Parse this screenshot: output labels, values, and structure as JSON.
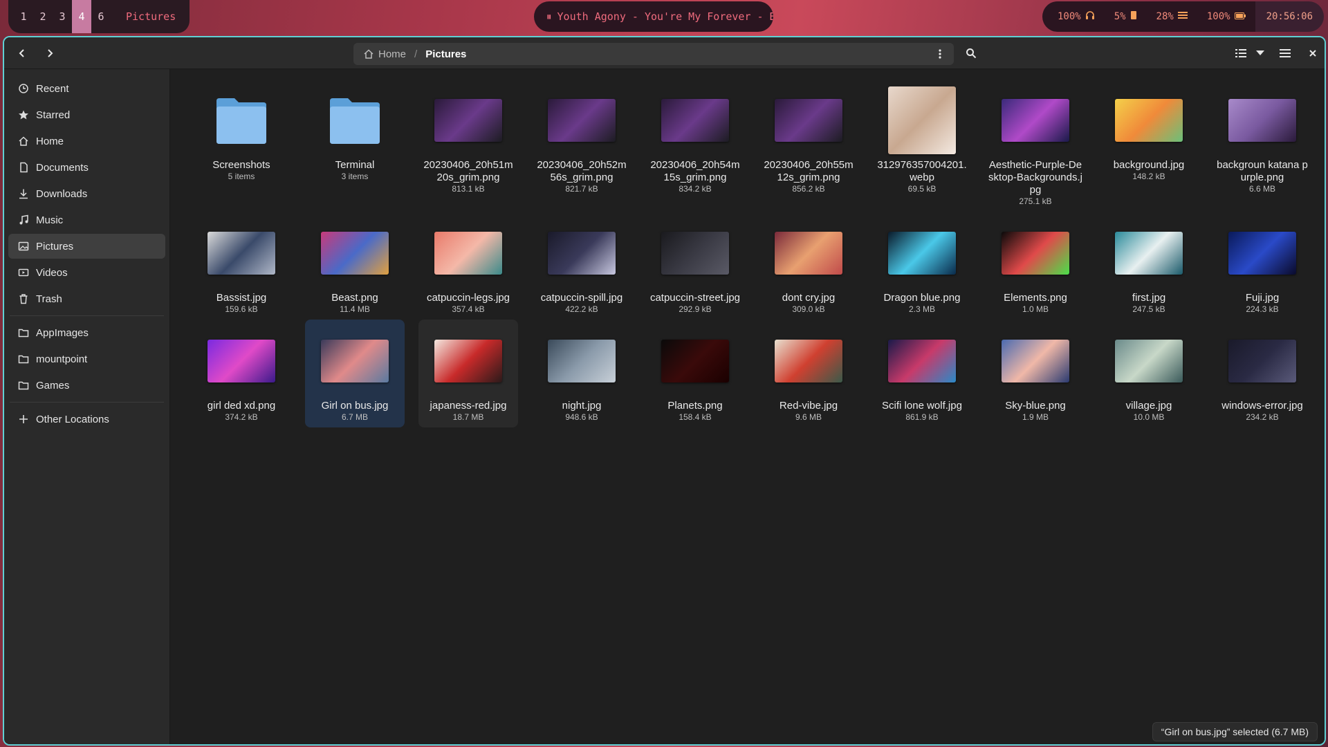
{
  "topbar": {
    "workspaces": [
      "1",
      "2",
      "3",
      "4",
      "6"
    ],
    "active_workspace": "4",
    "window_title": "Pictures",
    "media": {
      "icon": "pause-icon",
      "text": "Youth Agony - You're My Forever - Be"
    },
    "status": [
      {
        "value": "100%",
        "icon": "headphones-icon"
      },
      {
        "value": "5%",
        "icon": "battery-low-icon"
      },
      {
        "value": "28%",
        "icon": "memory-icon"
      },
      {
        "value": "100%",
        "icon": "battery-full-icon"
      }
    ],
    "clock": "20:56:06"
  },
  "headerbar": {
    "breadcrumb": {
      "home": "Home",
      "current": "Pictures"
    }
  },
  "sidebar": {
    "items": [
      {
        "label": "Recent",
        "icon": "clock-icon"
      },
      {
        "label": "Starred",
        "icon": "star-icon"
      },
      {
        "label": "Home",
        "icon": "home-icon"
      },
      {
        "label": "Documents",
        "icon": "document-icon"
      },
      {
        "label": "Downloads",
        "icon": "download-icon"
      },
      {
        "label": "Music",
        "icon": "music-icon"
      },
      {
        "label": "Pictures",
        "icon": "picture-icon",
        "active": true
      },
      {
        "label": "Videos",
        "icon": "video-icon"
      },
      {
        "label": "Trash",
        "icon": "trash-icon"
      }
    ],
    "places": [
      {
        "label": "AppImages",
        "icon": "folder-icon"
      },
      {
        "label": "mountpoint",
        "icon": "folder-icon"
      },
      {
        "label": "Games",
        "icon": "folder-icon"
      }
    ],
    "other": {
      "label": "Other Locations",
      "icon": "plus-icon"
    }
  },
  "files": [
    {
      "name": "Screenshots",
      "size": "5 items",
      "kind": "folder"
    },
    {
      "name": "Terminal",
      "size": "3 items",
      "kind": "folder"
    },
    {
      "name": "20230406_20h51m20s_grim.png",
      "size": "813.1 kB",
      "colors": [
        "#2a1a3a",
        "#6a3a8a",
        "#1c1c22"
      ]
    },
    {
      "name": "20230406_20h52m56s_grim.png",
      "size": "821.7 kB",
      "colors": [
        "#2a1a3a",
        "#6a3a8a",
        "#1c1c22"
      ]
    },
    {
      "name": "20230406_20h54m15s_grim.png",
      "size": "834.2 kB",
      "colors": [
        "#2a1a3a",
        "#6a3a8a",
        "#1c1c22"
      ]
    },
    {
      "name": "20230406_20h55m12s_grim.png",
      "size": "856.2 kB",
      "colors": [
        "#2a1a3a",
        "#6a3a8a",
        "#1c1c22"
      ]
    },
    {
      "name": "312976357004201.webp",
      "size": "69.5 kB",
      "colors": [
        "#e8d8cc",
        "#c8a890",
        "#f4eae2"
      ],
      "tall": true
    },
    {
      "name": "Aesthetic-Purple-Desktop-Backgrounds.jpg",
      "size": "275.1 kB",
      "colors": [
        "#3a2a7a",
        "#b04ac8",
        "#1a1a4a"
      ]
    },
    {
      "name": "background.jpg",
      "size": "148.2 kB",
      "colors": [
        "#f4d04a",
        "#f08a3a",
        "#6ac07a"
      ]
    },
    {
      "name": "backgroun katana purple.png",
      "size": "6.6 MB",
      "colors": [
        "#a88aca",
        "#7a5aa0",
        "#2a1a3a"
      ]
    },
    {
      "name": "Bassist.jpg",
      "size": "159.6 kB",
      "colors": [
        "#dadada",
        "#3a4a6a",
        "#b0b8c8"
      ]
    },
    {
      "name": "Beast.png",
      "size": "11.4 MB",
      "colors": [
        "#c83a7a",
        "#4a6ac8",
        "#e0a040"
      ]
    },
    {
      "name": "catpuccin-legs.jpg",
      "size": "357.4 kB",
      "colors": [
        "#e87a6a",
        "#f4b8a8",
        "#3a8a8a"
      ]
    },
    {
      "name": "catpuccin-spill.jpg",
      "size": "422.2 kB",
      "colors": [
        "#1a1a2a",
        "#3a3a5a",
        "#c8c8e0"
      ]
    },
    {
      "name": "catpuccin-street.jpg",
      "size": "292.9 kB",
      "colors": [
        "#1a1a1e",
        "#3a3a44",
        "#5a5a66"
      ]
    },
    {
      "name": "dont cry.jpg",
      "size": "309.0 kB",
      "colors": [
        "#7a2a3a",
        "#e8a070",
        "#c04a4a"
      ]
    },
    {
      "name": "Dragon blue.png",
      "size": "2.3 MB",
      "colors": [
        "#0a1a2a",
        "#4ac8e8",
        "#0a2a4a"
      ]
    },
    {
      "name": "Elements.png",
      "size": "1.0 MB",
      "colors": [
        "#0a0a0a",
        "#e04a4a",
        "#4ae04a"
      ]
    },
    {
      "name": "first.jpg",
      "size": "247.5 kB",
      "colors": [
        "#2a8a9a",
        "#e8f0f0",
        "#1a5a6a"
      ]
    },
    {
      "name": "Fuji.jpg",
      "size": "224.3 kB",
      "colors": [
        "#0a1a5a",
        "#2a4ac8",
        "#0a0a2a"
      ]
    },
    {
      "name": "girl ded xd.png",
      "size": "374.2 kB",
      "colors": [
        "#7a2ae0",
        "#e04ac8",
        "#3a1a8a"
      ]
    },
    {
      "name": "Girl on bus.jpg",
      "size": "6.7 MB",
      "colors": [
        "#3a3a5a",
        "#e08a8a",
        "#5a7aa0"
      ],
      "selected": true
    },
    {
      "name": "japaness-red.jpg",
      "size": "18.7 MB",
      "colors": [
        "#f4e8e0",
        "#c82a2a",
        "#2a1a1a"
      ],
      "hover": true
    },
    {
      "name": "night.jpg",
      "size": "948.6 kB",
      "colors": [
        "#3a4a5a",
        "#8a9aaa",
        "#c8d0d8"
      ]
    },
    {
      "name": "Planets.png",
      "size": "158.4 kB",
      "colors": [
        "#0a0a0a",
        "#3a0a0a",
        "#1a0000"
      ]
    },
    {
      "name": "Red-vibe.jpg",
      "size": "9.6 MB",
      "colors": [
        "#e8e0d0",
        "#d04030",
        "#3a5a4a"
      ]
    },
    {
      "name": "Scifi lone wolf.jpg",
      "size": "861.9 kB",
      "colors": [
        "#1a1a4a",
        "#c83a6a",
        "#2a8ac8"
      ]
    },
    {
      "name": "Sky-blue.png",
      "size": "1.9 MB",
      "colors": [
        "#4a6ab0",
        "#f0b8a8",
        "#2a3a70"
      ]
    },
    {
      "name": "village.jpg",
      "size": "10.0 MB",
      "colors": [
        "#6a8a8a",
        "#c8d8c8",
        "#3a5a5a"
      ]
    },
    {
      "name": "windows-error.jpg",
      "size": "234.2 kB",
      "colors": [
        "#1a1a2a",
        "#2a2a44",
        "#5a5a7a"
      ]
    }
  ],
  "statusbar": {
    "text": "“Girl on bus.jpg” selected (6.7 MB)"
  }
}
